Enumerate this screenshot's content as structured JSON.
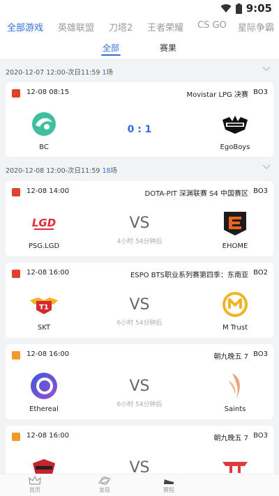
{
  "status_bar": {
    "time": "9:05"
  },
  "game_tabs": [
    "全部游戏",
    "英雄联盟",
    "刀塔2",
    "王者荣耀",
    "CS GO",
    "星际争霸"
  ],
  "sub_tabs": [
    "全部",
    "赛果"
  ],
  "sections": [
    {
      "range": "2020-12-07 12:00-次日11:59 ",
      "count": "1",
      "suffix": "场"
    },
    {
      "range": "2020-12-08 12:00-次日11:59 ",
      "count": "18",
      "suffix": "场"
    }
  ],
  "matches": [
    {
      "game": "dota-icon",
      "time": "12-08 08:15",
      "event": "Movistar LPG 决赛",
      "bo": "BO3",
      "team_left": "BC",
      "team_right": "EgoBoys",
      "score": "0 : 1"
    },
    {
      "game": "dota-icon",
      "time": "12-08 14:00",
      "event": "DOTA-PIT 深渊联赛 S4 中国赛区",
      "bo": "BO3",
      "team_left": "PSG.LGD",
      "team_right": "EHOME",
      "vs": "VS",
      "countdown": "4小时 54分钟后"
    },
    {
      "game": "dota-icon",
      "time": "12-08 16:00",
      "event": "ESPO BTS职业系列赛第四季：东南亚",
      "bo": "BO2",
      "team_left": "SKT",
      "team_right": "M Trust",
      "vs": "VS",
      "countdown": "6小时 54分钟后"
    },
    {
      "game": "csgo-icon",
      "time": "12-08 16:00",
      "event": "朝九晚五 7",
      "bo": "BO3",
      "team_left": "Ethereal",
      "team_right": "Saints",
      "vs": "VS",
      "countdown": "6小时 54分钟后"
    },
    {
      "game": "csgo-icon",
      "time": "12-08 16:00",
      "event": "朝九晚五 7",
      "bo": "BO3",
      "vs": "VS"
    }
  ],
  "bottom_nav": [
    "首页",
    "发现",
    "赛程"
  ],
  "colors": {
    "accent": "#2f6fdc",
    "dota": "#e0432b",
    "csgo": "#f09a2a"
  }
}
